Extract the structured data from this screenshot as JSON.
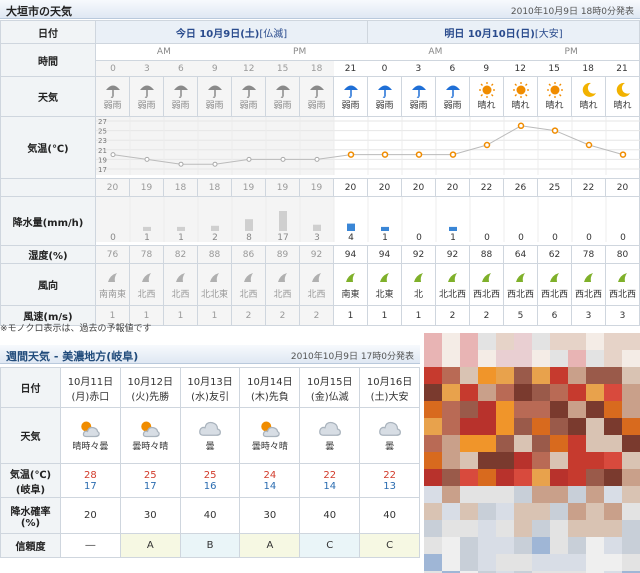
{
  "top": {
    "title": "大垣市の天気",
    "announced": "2010年10月9日 18時0分発表",
    "labels": {
      "date": "日付",
      "time": "時間",
      "weather": "天気",
      "temp": "気温(℃)",
      "rain": "降水量(mm/h)",
      "humidity": "湿度(%)",
      "wind_dir": "風向",
      "wind_speed": "風速(m/s)"
    },
    "days": [
      {
        "label": "今日 10月9日(土)",
        "rokuyo": "[仏滅]",
        "am": "AM",
        "pm": "PM"
      },
      {
        "label": "明日 10月10日(日)",
        "rokuyo": "[大安]",
        "am": "AM",
        "pm": "PM"
      }
    ],
    "hours": [
      "0",
      "3",
      "6",
      "9",
      "12",
      "15",
      "18",
      "21",
      "0",
      "3",
      "6",
      "9",
      "12",
      "15",
      "18",
      "21"
    ],
    "weather": [
      "弱雨",
      "弱雨",
      "弱雨",
      "弱雨",
      "弱雨",
      "弱雨",
      "弱雨",
      "弱雨",
      "弱雨",
      "弱雨",
      "弱雨",
      "晴れ",
      "晴れ",
      "晴れ",
      "晴れ",
      "晴れ"
    ],
    "weather_icons": [
      "umbrella-icon",
      "umbrella-icon",
      "umbrella-icon",
      "umbrella-icon",
      "umbrella-icon",
      "umbrella-icon",
      "umbrella-icon",
      "umbrella-icon",
      "umbrella-icon",
      "umbrella-icon",
      "umbrella-icon",
      "sun-icon",
      "sun-icon",
      "sun-icon",
      "moon-icon",
      "moon-icon"
    ],
    "temp_axis": [
      "27",
      "25",
      "23",
      "21",
      "19",
      "17"
    ],
    "temps": [
      "20",
      "19",
      "18",
      "18",
      "19",
      "19",
      "19",
      "20",
      "20",
      "20",
      "20",
      "22",
      "26",
      "25",
      "22",
      "20"
    ],
    "temp_values": [
      20,
      19,
      18,
      18,
      19,
      19,
      19,
      20,
      20,
      20,
      20,
      22,
      26,
      25,
      22,
      20
    ],
    "rain": [
      "0",
      "1",
      "1",
      "2",
      "8",
      "17",
      "3",
      "4",
      "1",
      "0",
      "1",
      "0",
      "0",
      "0",
      "0",
      "0"
    ],
    "rain_values": [
      0,
      1,
      1,
      2,
      8,
      17,
      3,
      4,
      1,
      0,
      1,
      0,
      0,
      0,
      0,
      0
    ],
    "humidity": [
      "76",
      "78",
      "82",
      "88",
      "86",
      "89",
      "92",
      "94",
      "94",
      "92",
      "92",
      "88",
      "64",
      "62",
      "78",
      "80"
    ],
    "wind_dir": [
      "南南東",
      "北西",
      "北西",
      "北北東",
      "北西",
      "北西",
      "北西",
      "南東",
      "北東",
      "北",
      "北北西",
      "西北西",
      "西北西",
      "西北西",
      "西北西",
      "西北西"
    ],
    "wind_speed": [
      "1",
      "1",
      "1",
      "1",
      "2",
      "2",
      "2",
      "1",
      "1",
      "1",
      "2",
      "2",
      "5",
      "6",
      "3",
      "3"
    ],
    "past_count": 7
  },
  "note": "※モノクロ表示は、過去の予報値です",
  "weekly": {
    "title": "週間天気 - 美濃地方(岐阜)",
    "announced": "2010年10月9日 17時0分発表",
    "labels": {
      "date": "日付",
      "weather": "天気",
      "temp1": "気温(℃)",
      "temp2": "(岐阜)",
      "rain1": "降水確率",
      "rain2": "(%)",
      "reliability": "信頼度"
    },
    "days": [
      {
        "date": "10月11日",
        "dow": "(月)赤口",
        "weather": "晴時々曇",
        "icon": "sun-cloud-icon",
        "high": "28",
        "low": "17",
        "rain": "20",
        "rel": "―"
      },
      {
        "date": "10月12日",
        "dow": "(火)先勝",
        "weather": "曇時々晴",
        "icon": "sun-cloud-icon",
        "high": "25",
        "low": "17",
        "rain": "30",
        "rel": "A"
      },
      {
        "date": "10月13日",
        "dow": "(水)友引",
        "weather": "曇",
        "icon": "cloud-icon",
        "high": "25",
        "low": "16",
        "rain": "40",
        "rel": "B"
      },
      {
        "date": "10月14日",
        "dow": "(木)先負",
        "weather": "曇時々晴",
        "icon": "sun-cloud-icon",
        "high": "24",
        "low": "14",
        "rain": "30",
        "rel": "A"
      },
      {
        "date": "10月15日",
        "dow": "(金)仏滅",
        "weather": "曇",
        "icon": "cloud-icon",
        "high": "22",
        "low": "14",
        "rain": "40",
        "rel": "C"
      },
      {
        "date": "10月16日",
        "dow": "(土)大安",
        "weather": "曇",
        "icon": "cloud-icon",
        "high": "22",
        "low": "13",
        "rain": "40",
        "rel": "C"
      }
    ]
  },
  "colors": {
    "accent": "#2a4b8d",
    "orange": "#f08c00",
    "high": "#d23c2c",
    "low": "#2b6cb0"
  }
}
